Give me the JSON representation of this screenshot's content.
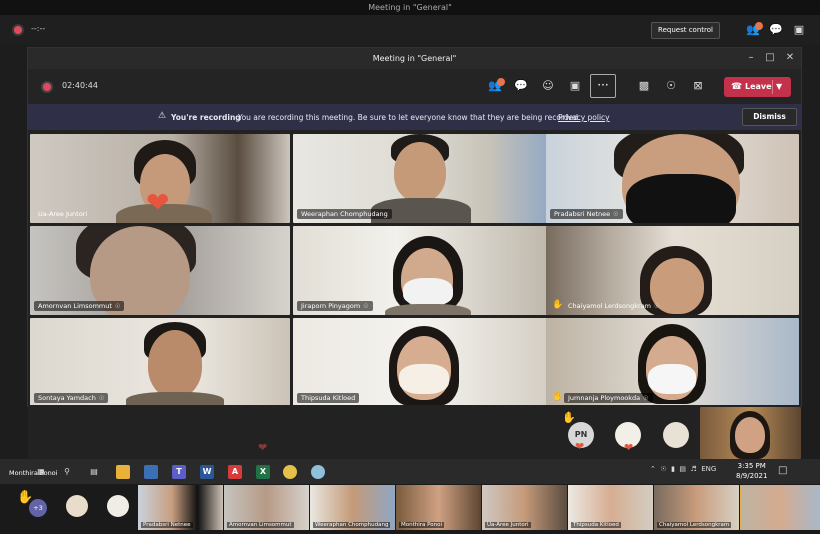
{
  "outer": {
    "title": "Meeting in \"General\"",
    "timer": "--:--",
    "request_control": "Request control",
    "people_count": "1"
  },
  "window": {
    "title": "Meeting in \"General\"",
    "timer": "02:40:44",
    "people_badge": "3",
    "more_label": "···",
    "leave_label": "Leave"
  },
  "banner": {
    "title": "You're recording",
    "message": "You are recording this meeting. Be sure to let everyone know that they are being recorded.",
    "link": "Privacy policy",
    "dismiss": "Dismiss"
  },
  "participants": [
    {
      "name": "Ua-Aree Juntori",
      "muted": false,
      "hand": false,
      "reaction": "heart"
    },
    {
      "name": "Weeraphan Chomphudang",
      "muted": false,
      "hand": false
    },
    {
      "name": "Pradabsri Netnee",
      "muted": true,
      "hand": false
    },
    {
      "name": "Amornvan Limsommut",
      "muted": true,
      "hand": false
    },
    {
      "name": "Jiraporn Pinyagom",
      "muted": true,
      "hand": false
    },
    {
      "name": "Chaiyamol Lerdsongkram",
      "muted": true,
      "hand": true
    },
    {
      "name": "Sontaya Yamdach",
      "muted": true,
      "hand": false
    },
    {
      "name": "Thipsuda Kitloed",
      "muted": false,
      "hand": false
    },
    {
      "name": "Jumnanja Ploymookda",
      "muted": true,
      "hand": true
    }
  ],
  "floating": {
    "initials": "PN"
  },
  "taskbar": {
    "username": "Monthira Ponoi",
    "language": "ENG",
    "time": "3:35 PM",
    "date": "8/9/2021"
  },
  "strip": {
    "plus_count": "+3",
    "thumbs": [
      {
        "name": "Pradabsri Netnee"
      },
      {
        "name": "Amornvan Limsommut"
      },
      {
        "name": "Weeraphan Chomphudang"
      },
      {
        "name": "Monthira Ponoi"
      },
      {
        "name": "Ua-Aree Juntori"
      },
      {
        "name": "Thipsuda Kitloed"
      },
      {
        "name": "Chaiyamol Lerdsongkram"
      },
      {
        "name": ""
      }
    ]
  },
  "colors": {
    "leave": "#c4314b",
    "banner": "#2f3047",
    "accent": "#6264a7",
    "record": "#e04a5e",
    "heart": "#e8553f"
  }
}
